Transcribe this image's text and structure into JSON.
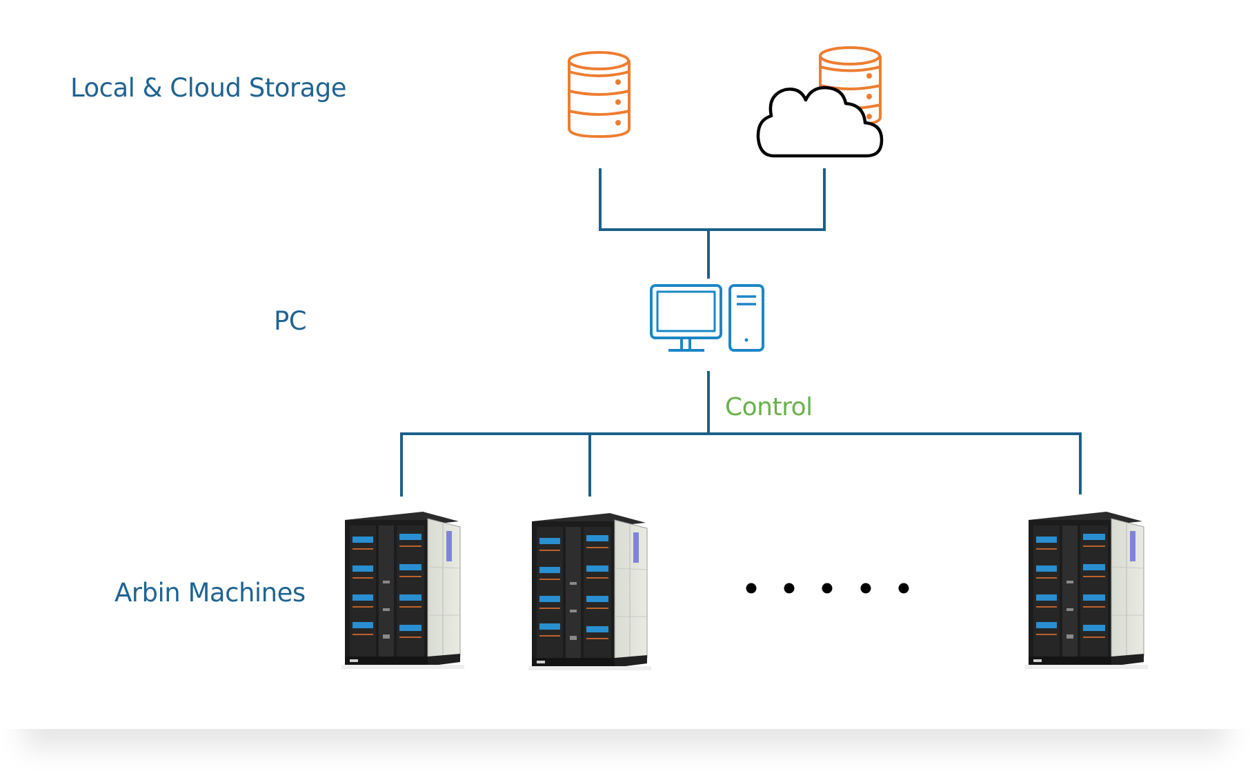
{
  "diagram": {
    "tiers": {
      "storage": "Local & Cloud Storage",
      "pc": "PC",
      "machines": "Arbin Machines"
    },
    "connector_label": "Control",
    "nodes": [
      {
        "id": "local-storage",
        "icon": "database-icon",
        "tier": "storage"
      },
      {
        "id": "cloud-storage",
        "icon": "cloud-database-icon",
        "tier": "storage"
      },
      {
        "id": "pc",
        "icon": "desktop-computer-icon",
        "tier": "pc"
      },
      {
        "id": "machine-1",
        "icon": "arbin-cabinet-icon",
        "tier": "machines"
      },
      {
        "id": "machine-2",
        "icon": "arbin-cabinet-icon",
        "tier": "machines"
      },
      {
        "id": "machine-n",
        "icon": "arbin-cabinet-icon",
        "tier": "machines"
      }
    ],
    "ellipsis": "• • • • •",
    "edges": [
      {
        "from": "local-storage",
        "to": "pc"
      },
      {
        "from": "cloud-storage",
        "to": "pc"
      },
      {
        "from": "pc",
        "to": "machine-1",
        "label": "Control"
      },
      {
        "from": "pc",
        "to": "machine-2",
        "label": "Control"
      },
      {
        "from": "pc",
        "to": "machine-n",
        "label": "Control"
      }
    ],
    "colors": {
      "line": "#1B6089",
      "label_text": "#1F6391",
      "control_text": "#6AB04C",
      "database": "#ED7D31",
      "pc_icon": "#1A86C6",
      "cloud_stroke": "#000000"
    }
  }
}
